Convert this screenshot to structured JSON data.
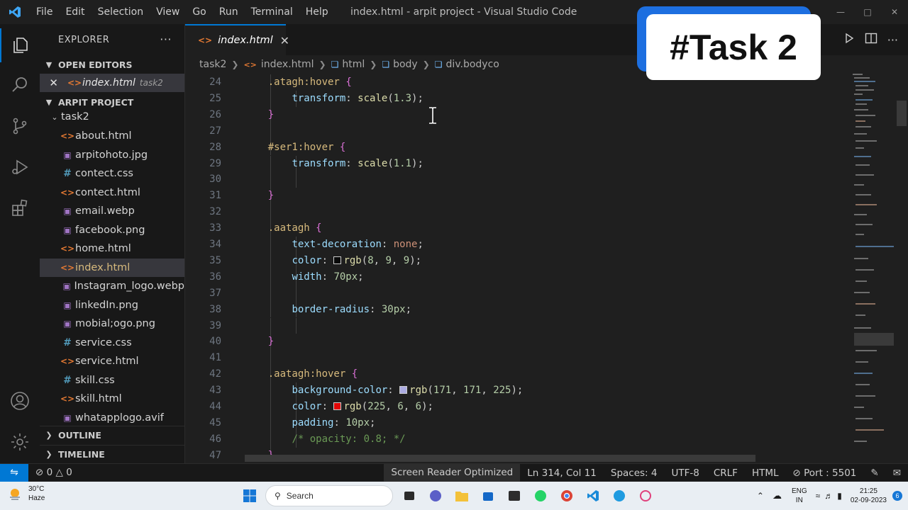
{
  "titlebar": {
    "menus": [
      "File",
      "Edit",
      "Selection",
      "View",
      "Go",
      "Run",
      "Terminal",
      "Help"
    ],
    "window_title": "index.html - arpit project - Visual Studio Code"
  },
  "sidebar": {
    "title": "EXPLORER",
    "open_editors_label": "OPEN EDITORS",
    "open_editor": {
      "name": "index.html",
      "hint": "task2"
    },
    "project_label": "ARPIT PROJECT",
    "folder": "task2",
    "files": [
      {
        "name": "about.html",
        "type": "html"
      },
      {
        "name": "arpitohoto.jpg",
        "type": "img"
      },
      {
        "name": "contect.css",
        "type": "css"
      },
      {
        "name": "contect.html",
        "type": "html"
      },
      {
        "name": "email.webp",
        "type": "img"
      },
      {
        "name": "facebook.png",
        "type": "img"
      },
      {
        "name": "home.html",
        "type": "html"
      },
      {
        "name": "index.html",
        "type": "html"
      },
      {
        "name": "Instagram_logo.webp",
        "type": "img"
      },
      {
        "name": "linkedIn.png",
        "type": "img"
      },
      {
        "name": "mobial;ogo.png",
        "type": "img"
      },
      {
        "name": "service.css",
        "type": "css"
      },
      {
        "name": "service.html",
        "type": "html"
      },
      {
        "name": "skill.css",
        "type": "css"
      },
      {
        "name": "skill.html",
        "type": "html"
      },
      {
        "name": "whatapplogo.avif",
        "type": "img"
      }
    ],
    "outline_label": "OUTLINE",
    "timeline_label": "TIMELINE"
  },
  "editor": {
    "tab_label": "index.html",
    "breadcrumbs": [
      "task2",
      "index.html",
      "html",
      "body",
      "div.bodyco"
    ],
    "line_numbers": [
      "24",
      "25",
      "26",
      "27",
      "28",
      "29",
      "30",
      "31",
      "32",
      "33",
      "34",
      "35",
      "36",
      "37",
      "38",
      "39",
      "40",
      "41",
      "42",
      "43",
      "44",
      "45",
      "46",
      "47"
    ]
  },
  "overlay": {
    "badge_text": "#Task 2"
  },
  "statusbar": {
    "problems_errors": "0",
    "problems_warnings": "0",
    "screen_reader": "Screen Reader Optimized",
    "cursor_position": "Ln 314, Col 11",
    "spaces": "Spaces: 4",
    "encoding": "UTF-8",
    "eol": "CRLF",
    "language": "HTML",
    "port": "Port : 5501"
  },
  "taskbar": {
    "weather_temp": "30°C",
    "weather_desc": "Haze",
    "search_placeholder": "Search",
    "lang_top": "ENG",
    "lang_bottom": "IN",
    "time": "21:25",
    "date": "02-09-2023",
    "notification_count": "6"
  },
  "colors": {
    "accent": "#0078d4",
    "color_swatch_1": "#080909",
    "color_swatch_2": "#ababe1",
    "color_swatch_3": "#e10606"
  }
}
